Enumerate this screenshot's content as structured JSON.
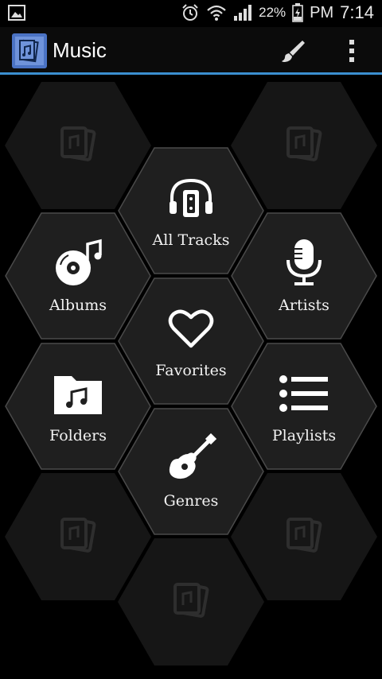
{
  "status_bar": {
    "battery": "22%",
    "time_period": "PM",
    "time": "7:14"
  },
  "app": {
    "title": "Music"
  },
  "colors": {
    "accent": "#3b8fd0",
    "hex_fill": "#1f1f1f",
    "hex_empty_fill": "#161616",
    "hex_stroke": "#4a4a4a"
  },
  "tiles": {
    "all_tracks": {
      "label": "All Tracks",
      "icon": "headphones-icon"
    },
    "albums": {
      "label": "Albums",
      "icon": "disc-icon"
    },
    "artists": {
      "label": "Artists",
      "icon": "microphone-icon"
    },
    "favorites": {
      "label": "Favorites",
      "icon": "heart-icon"
    },
    "folders": {
      "label": "Folders",
      "icon": "folder-icon"
    },
    "playlists": {
      "label": "Playlists",
      "icon": "list-icon"
    },
    "genres": {
      "label": "Genres",
      "icon": "guitar-icon"
    }
  }
}
